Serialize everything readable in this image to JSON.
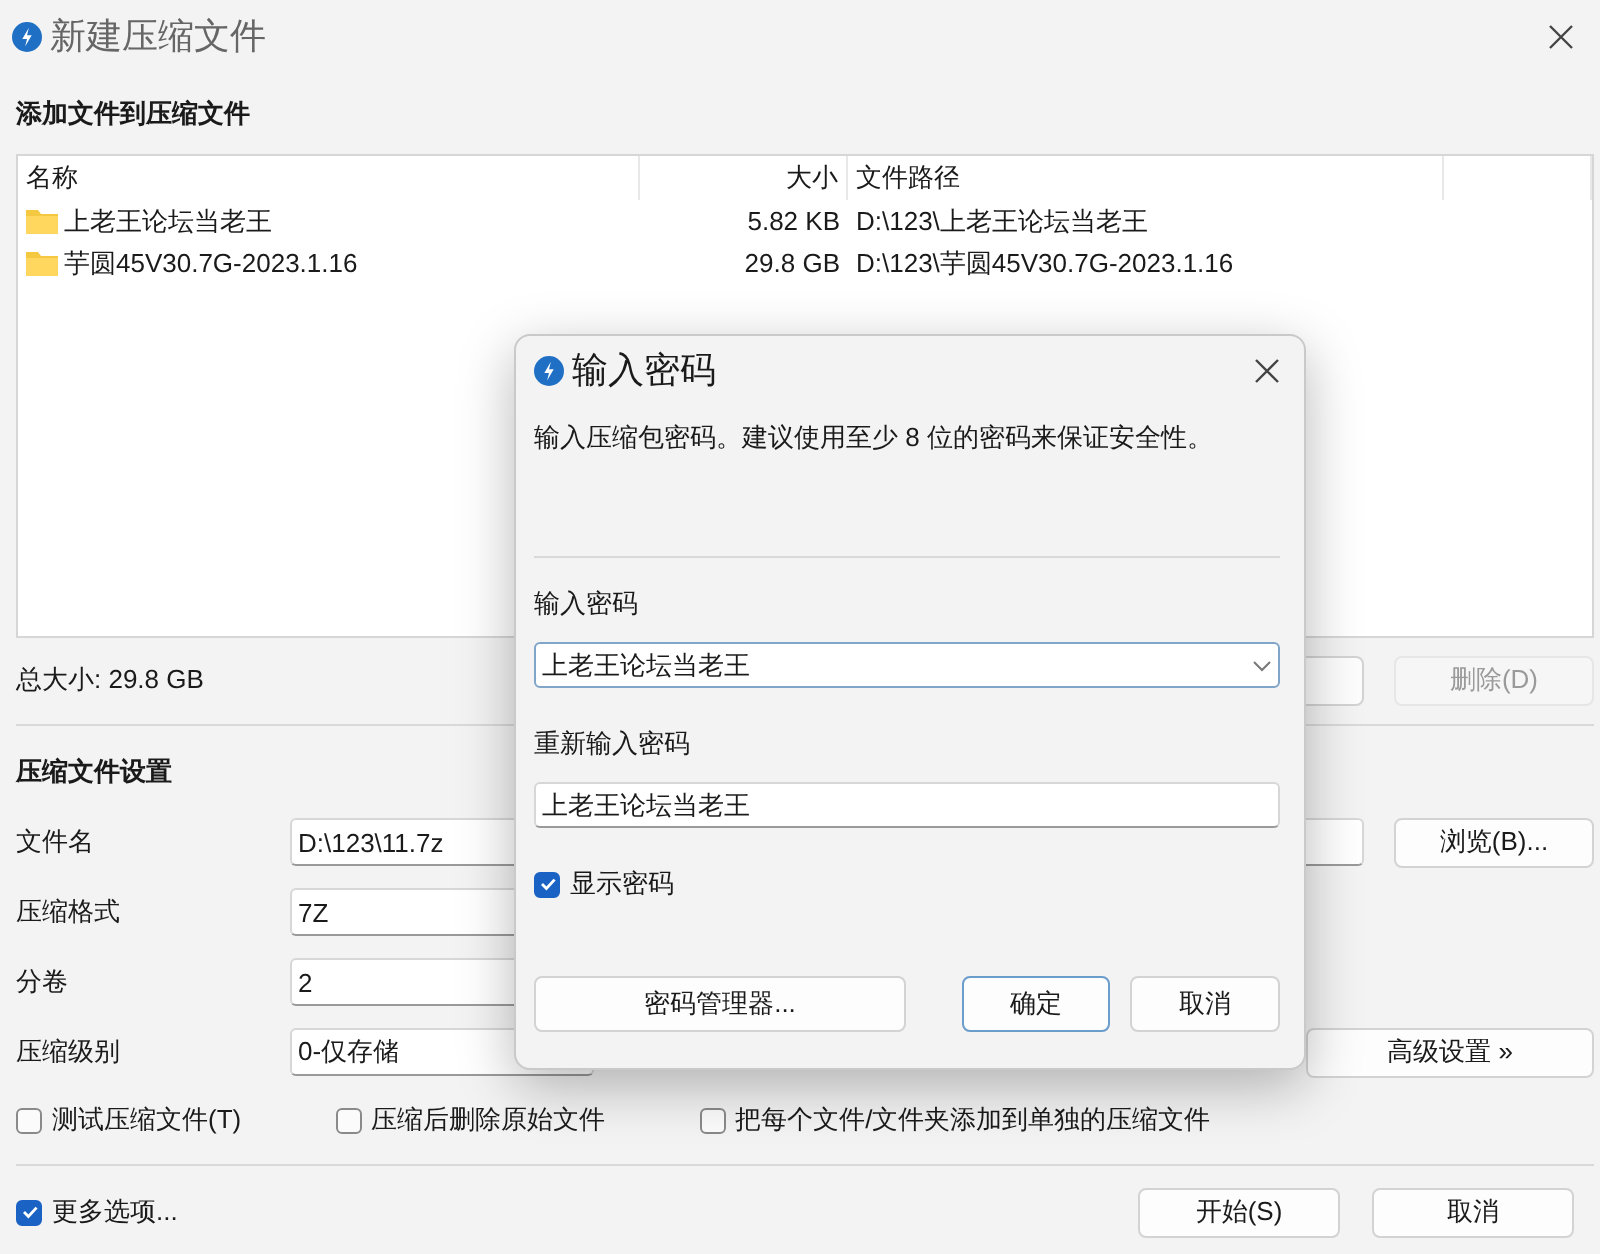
{
  "window": {
    "title": "新建压缩文件"
  },
  "files": {
    "heading": "添加文件到压缩文件",
    "columns": [
      "名称",
      "大小",
      "文件路径"
    ],
    "rows": [
      {
        "name": "上老王论坛当老王",
        "size": "5.82 KB",
        "path": "D:\\123\\上老王论坛当老王"
      },
      {
        "name": "芋圆45V30.7G-2023.1.16",
        "size": "29.8 GB",
        "path": "D:\\123\\芋圆45V30.7G-2023.1.16"
      }
    ],
    "total": "总大小: 29.8 GB",
    "delete_button": {
      "label": "删除(D)",
      "disabled": true
    }
  },
  "settings": {
    "heading": "压缩文件设置",
    "fields": [
      {
        "label": "文件名",
        "value": "D:\\123\\11.7z"
      },
      {
        "label": "压缩格式",
        "value": "7Z"
      },
      {
        "label": "分卷",
        "value": "2"
      },
      {
        "label": "压缩级别",
        "value": "0-仅存储"
      }
    ],
    "browse_button": "浏览(B)...",
    "advanced_button": "高级设置 »",
    "options": [
      {
        "label": "测试压缩文件(T)",
        "checked": false
      },
      {
        "label": "压缩后删除原始文件",
        "checked": false
      },
      {
        "label": "把每个文件/文件夹添加到单独的压缩文件",
        "checked": false
      }
    ]
  },
  "footer": {
    "more_options": {
      "label": "更多选项...",
      "checked": true
    },
    "buttons": [
      "开始(S)",
      "取消"
    ]
  },
  "dialog": {
    "title": "输入密码",
    "description": "输入压缩包密码。建议使用至少 8 位的密码来保证安全性。",
    "password_label": "输入密码",
    "password": "上老王论坛当老王",
    "confirm_label": "重新输入密码",
    "confirm": "上老王论坛当老王",
    "show_password": {
      "label": "显示密码",
      "checked": true
    },
    "buttons": [
      {
        "label": "密码管理器...",
        "default": false
      },
      {
        "label": "确定",
        "default": true
      },
      {
        "label": "取消",
        "default": false
      }
    ]
  }
}
